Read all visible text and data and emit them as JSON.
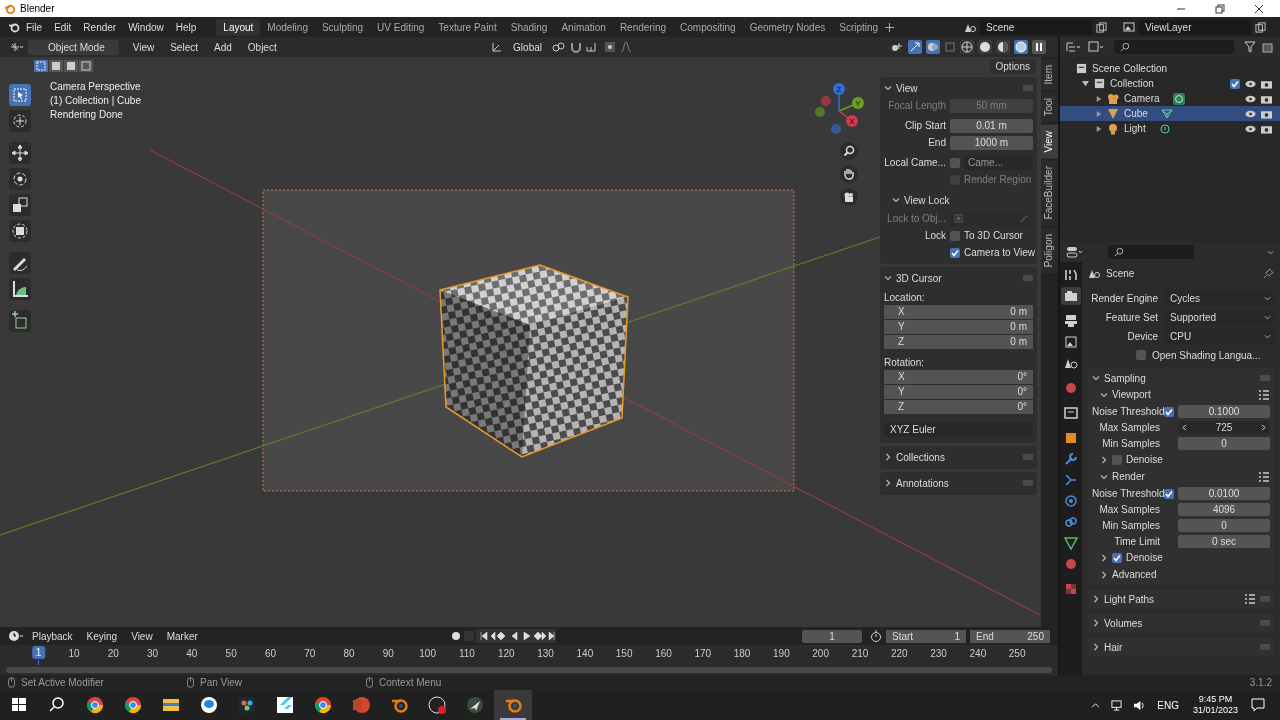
{
  "window": {
    "title": "Blender"
  },
  "menu": [
    "File",
    "Edit",
    "Render",
    "Window",
    "Help"
  ],
  "workspaces": [
    {
      "label": "Layout",
      "selected": true
    },
    {
      "label": "Modeling",
      "selected": false
    },
    {
      "label": "Sculpting",
      "selected": false
    },
    {
      "label": "UV Editing",
      "selected": false
    },
    {
      "label": "Texture Paint",
      "selected": false
    },
    {
      "label": "Shading",
      "selected": false
    },
    {
      "label": "Animation",
      "selected": false
    },
    {
      "label": "Rendering",
      "selected": false
    },
    {
      "label": "Compositing",
      "selected": false
    },
    {
      "label": "Geometry Nodes",
      "selected": false
    },
    {
      "label": "Scripting",
      "selected": false
    }
  ],
  "scene": "Scene",
  "view_layer": "ViewLayer",
  "viewport_header": {
    "mode": "Object Mode",
    "menus": [
      "View",
      "Select",
      "Add",
      "Object"
    ],
    "orientation": "Global",
    "options": "Options",
    "shading_modes": [
      {
        "kind": "wireframe",
        "selected": false
      },
      {
        "kind": "solid",
        "selected": false
      },
      {
        "kind": "material",
        "selected": false
      },
      {
        "kind": "rendered",
        "selected": true
      }
    ]
  },
  "toolbar": [
    {
      "kind": "select",
      "selected": true
    },
    {
      "kind": "cursor",
      "selected": false
    },
    {
      "kind": "move",
      "selected": false
    },
    {
      "kind": "rotate",
      "selected": false
    },
    {
      "kind": "scale",
      "selected": false
    },
    {
      "kind": "transform",
      "selected": false
    },
    {
      "kind": "annotate",
      "selected": false
    },
    {
      "kind": "measure",
      "selected": false
    },
    {
      "kind": "add_cube",
      "selected": false
    }
  ],
  "overlay_text": [
    "Camera Perspective",
    "(1) Collection | Cube",
    "Rendering Done"
  ],
  "gizmo": [
    {
      "label": "Z",
      "color": "#2e6fd0"
    },
    {
      "label": "Y",
      "color": "#6ba01f"
    },
    {
      "label": "X",
      "color": "#d23a4d"
    }
  ],
  "sidebar_tabs": [
    {
      "label": "Item",
      "selected": false
    },
    {
      "label": "Tool",
      "selected": false
    },
    {
      "label": "View",
      "selected": true
    },
    {
      "label": "FaceBuilder",
      "selected": false
    },
    {
      "label": "Poligon",
      "selected": false
    }
  ],
  "n_panel": {
    "view": {
      "title": "View",
      "expanded": true,
      "focal_length": {
        "label": "Focal Length",
        "value": "50 mm",
        "disabled": true
      },
      "clip_start": {
        "label": "Clip Start",
        "value": "0.01 m"
      },
      "clip_end": {
        "label": "End",
        "value": "1000 m"
      },
      "local_camera": {
        "label": "Local Came...",
        "value": "Came...",
        "checked": false
      },
      "render_region": {
        "label": "Render Region",
        "checked": false,
        "disabled": true
      },
      "view_lock": {
        "title": "View Lock",
        "expanded": true,
        "lock_to_object": {
          "label": "Lock to Obj...",
          "disabled": true
        },
        "lock_label": "Lock",
        "to_3d_cursor": {
          "label": "To 3D Cursor",
          "checked": false
        },
        "camera_to_view": {
          "label": "Camera to View",
          "checked": true
        }
      }
    },
    "cursor": {
      "title": "3D Cursor",
      "expanded": true,
      "location_label": "Location:",
      "location": [
        {
          "axis": "X",
          "value": "0 m"
        },
        {
          "axis": "Y",
          "value": "0 m"
        },
        {
          "axis": "Z",
          "value": "0 m"
        }
      ],
      "rotation_label": "Rotation:",
      "rotation": [
        {
          "axis": "X",
          "value": "0°"
        },
        {
          "axis": "Y",
          "value": "0°"
        },
        {
          "axis": "Z",
          "value": "0°"
        }
      ],
      "rotation_mode": "XYZ Euler"
    },
    "collapsed": [
      {
        "title": "Collections",
        "expanded": false
      },
      {
        "title": "Annotations",
        "expanded": false
      }
    ]
  },
  "outliner": {
    "root": "Scene Collection",
    "collections": [
      {
        "label": "Collection",
        "expanded": true,
        "checked": true,
        "children": [
          {
            "label": "Camera",
            "kind": "camera",
            "selected": false,
            "expanded": false
          },
          {
            "label": "Cube",
            "kind": "mesh",
            "selected": true,
            "expanded": false
          },
          {
            "label": "Light",
            "kind": "light",
            "selected": false,
            "expanded": false
          }
        ]
      }
    ]
  },
  "properties": {
    "tabs": [
      {
        "kind": "tool",
        "selected": false
      },
      {
        "kind": "render",
        "selected": true
      },
      {
        "kind": "output",
        "selected": false
      },
      {
        "kind": "view_layer",
        "selected": false
      },
      {
        "kind": "scene",
        "selected": false
      },
      {
        "kind": "world",
        "selected": false
      },
      {
        "kind": "collection",
        "selected": false
      },
      {
        "kind": "object",
        "selected": false
      },
      {
        "kind": "modifiers",
        "selected": false
      },
      {
        "kind": "particles",
        "selected": false
      },
      {
        "kind": "physics",
        "selected": false
      },
      {
        "kind": "constraints",
        "selected": false
      },
      {
        "kind": "data",
        "selected": false
      },
      {
        "kind": "material",
        "selected": false
      },
      {
        "kind": "texture",
        "selected": false
      }
    ],
    "context": "Scene",
    "settings": [
      {
        "label": "Render Engine",
        "value": "Cycles"
      },
      {
        "label": "Feature Set",
        "value": "Supported"
      },
      {
        "label": "Device",
        "value": "CPU"
      }
    ],
    "osl": {
      "label": "Open Shading Langua...",
      "checked": false
    },
    "panels": [
      {
        "title": "Sampling",
        "expanded": true,
        "children": [
          {
            "title": "Viewport",
            "expanded": true,
            "presets": true,
            "rows": [
              {
                "label": "Noise Threshold",
                "kind": "toggle_number",
                "checked": true,
                "value": "0.1000"
              },
              {
                "label": "Max Samples",
                "kind": "stepper",
                "value": "725"
              },
              {
                "label": "Min Samples",
                "kind": "number",
                "value": "0"
              }
            ]
          },
          {
            "title": "Denoise",
            "expanded": false,
            "checked": false
          },
          {
            "title": "Render",
            "expanded": true,
            "presets": true,
            "rows": [
              {
                "label": "Noise Threshold",
                "kind": "toggle_number",
                "checked": true,
                "value": "0.0100"
              },
              {
                "label": "Max Samples",
                "kind": "number",
                "value": "4096"
              },
              {
                "label": "Min Samples",
                "kind": "number",
                "value": "0"
              },
              {
                "label": "Time Limit",
                "kind": "number",
                "value": "0 sec"
              }
            ]
          },
          {
            "title": "Denoise",
            "expanded": false,
            "checked": true
          },
          {
            "title": "Advanced",
            "expanded": false
          }
        ]
      },
      {
        "title": "Light Paths",
        "expanded": false,
        "presets": true
      },
      {
        "title": "Volumes",
        "expanded": false
      },
      {
        "title": "Hair",
        "expanded": false
      }
    ]
  },
  "timeline": {
    "menus": [
      "Playback",
      "Keying",
      "View",
      "Marker"
    ],
    "current_frame": "1",
    "start_label": "Start",
    "start": "1",
    "end_label": "End",
    "end": "250",
    "ruler": [
      {
        "label": "1",
        "selected": true
      },
      {
        "label": "10",
        "selected": false
      },
      {
        "label": "20",
        "selected": false
      },
      {
        "label": "30",
        "selected": false
      },
      {
        "label": "40",
        "selected": false
      },
      {
        "label": "50",
        "selected": false
      },
      {
        "label": "60",
        "selected": false
      },
      {
        "label": "70",
        "selected": false
      },
      {
        "label": "80",
        "selected": false
      },
      {
        "label": "90",
        "selected": false
      },
      {
        "label": "100",
        "selected": false
      },
      {
        "label": "110",
        "selected": false
      },
      {
        "label": "120",
        "selected": false
      },
      {
        "label": "130",
        "selected": false
      },
      {
        "label": "140",
        "selected": false
      },
      {
        "label": "150",
        "selected": false
      },
      {
        "label": "160",
        "selected": false
      },
      {
        "label": "170",
        "selected": false
      },
      {
        "label": "180",
        "selected": false
      },
      {
        "label": "190",
        "selected": false
      },
      {
        "label": "200",
        "selected": false
      },
      {
        "label": "210",
        "selected": false
      },
      {
        "label": "220",
        "selected": false
      },
      {
        "label": "230",
        "selected": false
      },
      {
        "label": "240",
        "selected": false
      },
      {
        "label": "250",
        "selected": false
      }
    ]
  },
  "status_bar": {
    "hints": [
      "Set Active Modifier",
      "Pan View",
      "Context Menu"
    ],
    "version": "3.1.2"
  },
  "taskbar": {
    "apps": [
      {
        "kind": "windows",
        "selected": false
      },
      {
        "kind": "search",
        "selected": false
      },
      {
        "kind": "browser",
        "selected": false
      },
      {
        "kind": "browser",
        "selected": false
      },
      {
        "kind": "folder",
        "selected": false
      },
      {
        "kind": "chat",
        "selected": false
      },
      {
        "kind": "editor",
        "selected": false
      },
      {
        "kind": "bird",
        "selected": false
      },
      {
        "kind": "browser",
        "selected": false
      },
      {
        "kind": "slides",
        "selected": false
      },
      {
        "kind": "blender",
        "selected": false
      },
      {
        "kind": "recorder",
        "selected": false
      },
      {
        "kind": "arrow",
        "selected": false
      },
      {
        "kind": "blender",
        "selected": true
      }
    ],
    "language": "ENG",
    "time": "9:45 PM",
    "date": "31/01/2023"
  }
}
